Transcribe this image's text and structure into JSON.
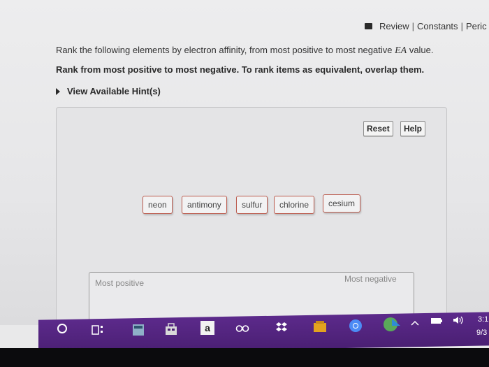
{
  "topbar": {
    "review": "Review",
    "constants": "Constants",
    "periodic": "Peric"
  },
  "question": {
    "prefix": "Rank the following elements by electron affinity, from most positive to most negative ",
    "ea": "EA",
    "suffix": " value."
  },
  "instruction": "Rank from most positive to most negative.  To rank items as equivalent, overlap them.",
  "hint_label": "View Available Hint(s)",
  "buttons": {
    "reset": "Reset",
    "help": "Help"
  },
  "items": [
    "neon",
    "antimony",
    "sulfur",
    "chlorine",
    "cesium"
  ],
  "ranking": {
    "left_label": "Most positive",
    "right_label": "Most negative"
  },
  "taskbar": {
    "time": "3:1",
    "date": "9/3",
    "icons": [
      "cortana-circle-icon",
      "task-view-icon",
      "calculator-icon",
      "store-icon",
      "amazon-icon",
      "infinity-icon",
      "dropbox-icon",
      "app-icon",
      "chrome-icon",
      "network-icon",
      "chevron-up-icon",
      "battery-icon",
      "volume-icon"
    ]
  },
  "colors": {
    "chip_border": "#bb5b4e",
    "taskbar": "#5c2a8b"
  }
}
